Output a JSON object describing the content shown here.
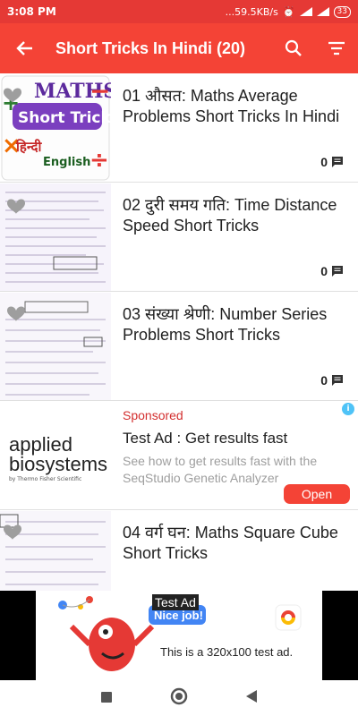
{
  "status_bar": {
    "time": "3:08 PM",
    "right_text": "...59.5KB/s",
    "battery": "33"
  },
  "app_bar": {
    "title": "Short Tricks In Hindi (20)"
  },
  "items": [
    {
      "title": "01 औसत: Maths Average Problems Short Tricks In Hindi",
      "count": "0"
    },
    {
      "title": "02 दुरी समय गति: Time Distance Speed Short Tricks",
      "count": "0"
    },
    {
      "title": "03 संख्या श्रेणी: Number Series Problems Short Tricks",
      "count": "0"
    },
    {
      "title": "04 वर्ग घन: Maths Square Cube Short Tricks",
      "count": ""
    }
  ],
  "thumbs": {
    "maths": "MATHS",
    "short_tricks": "Short Tricks",
    "hindi": "हिन्दी",
    "english": "English"
  },
  "ad": {
    "sponsored": "Sponsored",
    "title": "Test Ad : Get results fast",
    "description": "See how to get results fast with the SeqStudio Genetic Analyzer",
    "cta": "Open",
    "logo_line1": "applied",
    "logo_line2": "biosystems",
    "logo_line3": "by Thermo Fisher Scientific"
  },
  "banner": {
    "badge": "Test Ad",
    "nice": "Nice job!",
    "text": "This is a 320x100 test ad."
  },
  "colors": {
    "app_bar": "#f44336",
    "status_bar": "#e53935",
    "accent": "#d32f2f"
  }
}
